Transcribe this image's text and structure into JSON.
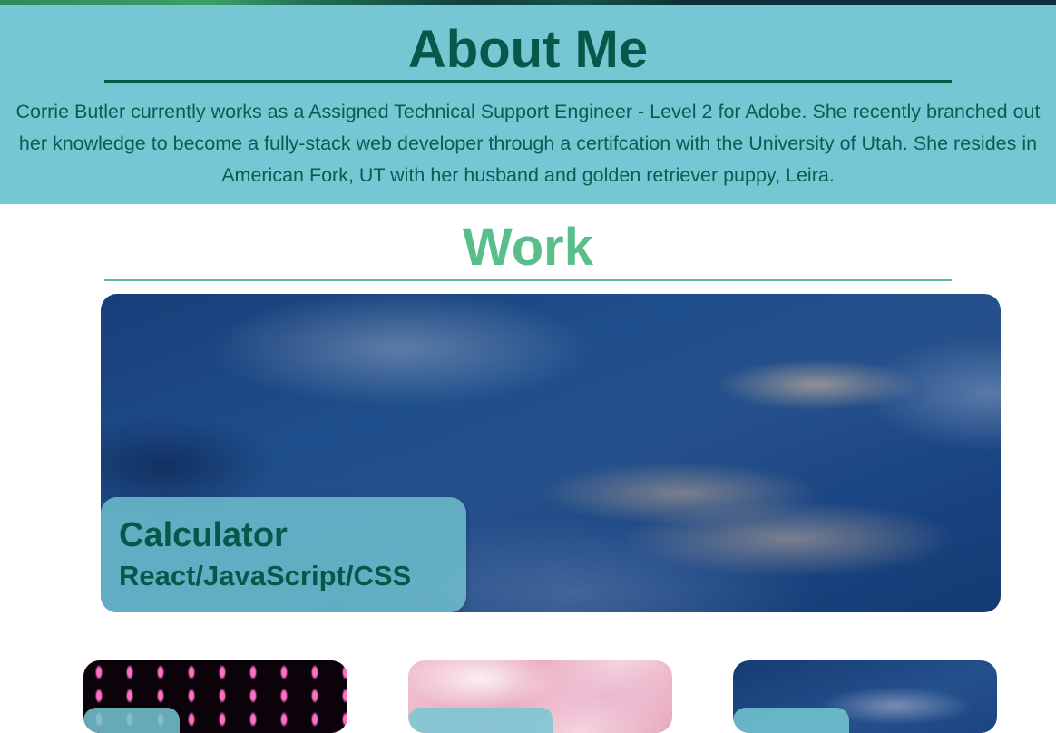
{
  "about": {
    "title": "About Me",
    "text": "Corrie Butler currently works as a Assigned Technical Support Engineer - Level 2 for Adobe. She recently branched out her knowledge to become a fully-stack web developer through a certifcation with the University of Utah. She resides in American Fork, UT with her husband and golden retriever puppy, Leira."
  },
  "work": {
    "title": "Work",
    "featured": {
      "title": "Calculator",
      "tech": "React/JavaScript/CSS"
    },
    "cards": [
      {
        "image": "pink-lights"
      },
      {
        "image": "pink-marble"
      },
      {
        "image": "blue-sky"
      }
    ]
  },
  "colors": {
    "about_bg": "#75c8d3",
    "dark_green": "#07574a",
    "work_green": "#58be8c"
  }
}
